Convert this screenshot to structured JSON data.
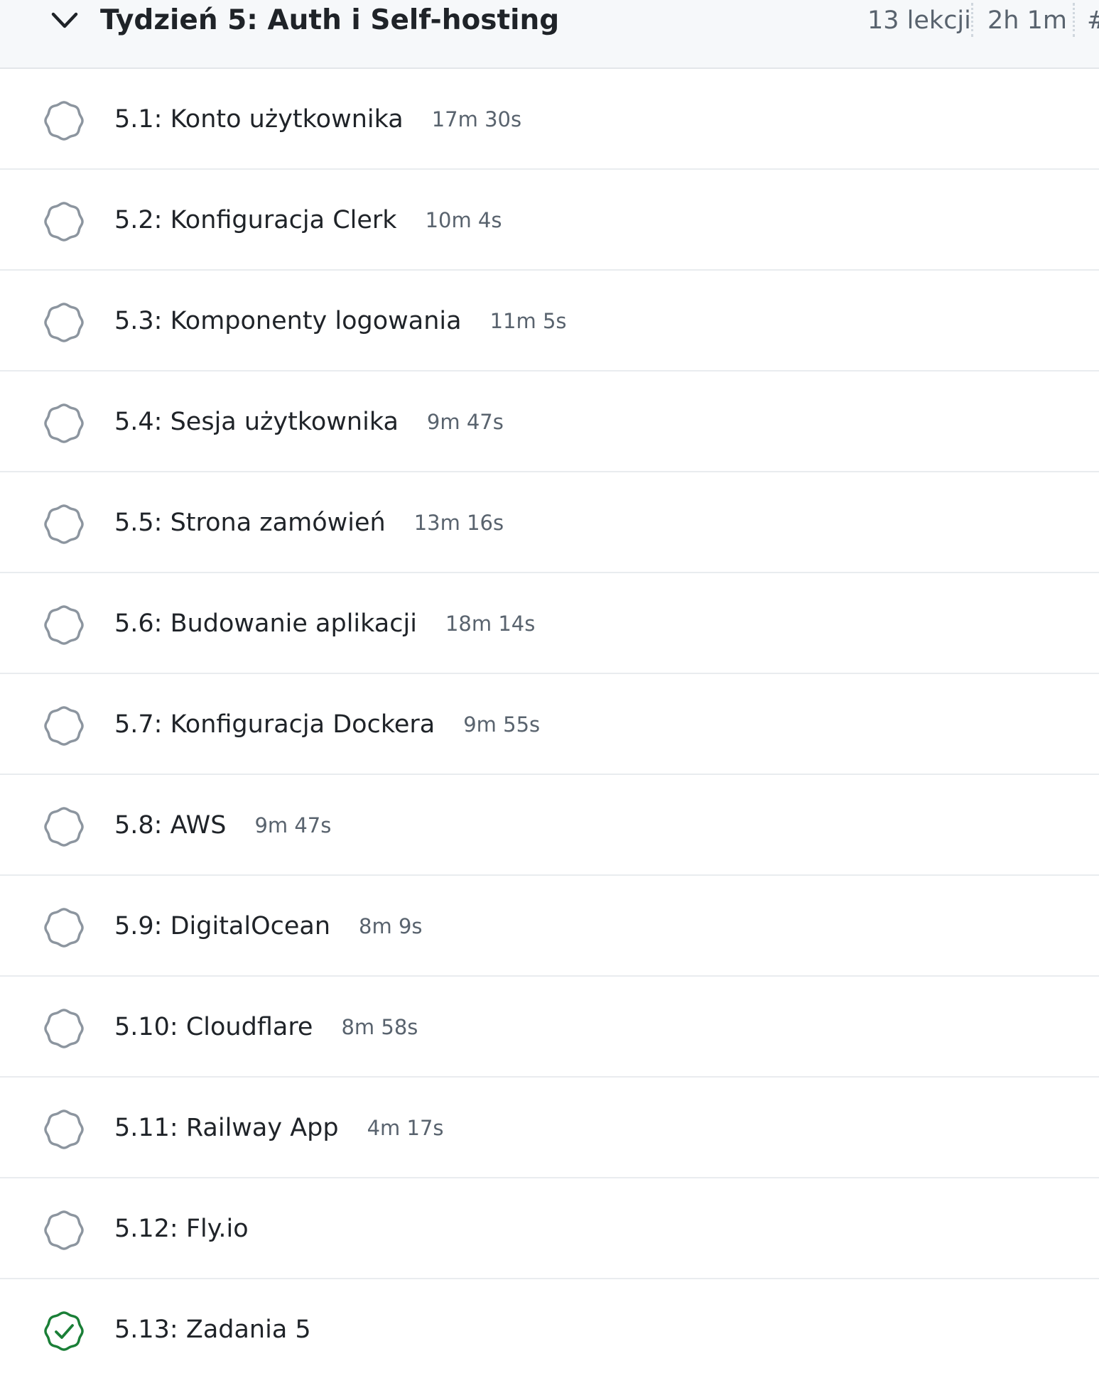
{
  "section": {
    "title": "Tydzień 5: Auth i Self-hosting",
    "lesson_count": "13 lekcji",
    "duration": "2h 1m",
    "extra": "#",
    "toggle_icon": "chevron-down-icon"
  },
  "colors": {
    "header_bg": "#f6f8fa",
    "pending": "#8c959f",
    "done": "#1a7f37",
    "text": "#1f2328",
    "muted": "#59636e"
  },
  "lessons": [
    {
      "title": "5.1: Konto użytkownika",
      "duration": "17m 30s",
      "completed": false
    },
    {
      "title": "5.2: Konfiguracja Clerk",
      "duration": "10m 4s",
      "completed": false
    },
    {
      "title": "5.3: Komponenty logowania",
      "duration": "11m 5s",
      "completed": false
    },
    {
      "title": "5.4: Sesja użytkownika",
      "duration": "9m 47s",
      "completed": false
    },
    {
      "title": "5.5: Strona zamówień",
      "duration": "13m 16s",
      "completed": false
    },
    {
      "title": "5.6: Budowanie aplikacji",
      "duration": "18m 14s",
      "completed": false
    },
    {
      "title": "5.7: Konfiguracja Dockera",
      "duration": "9m 55s",
      "completed": false
    },
    {
      "title": "5.8: AWS",
      "duration": "9m 47s",
      "completed": false
    },
    {
      "title": "5.9: DigitalOcean",
      "duration": "8m 9s",
      "completed": false
    },
    {
      "title": "5.10: Cloudflare",
      "duration": "8m 58s",
      "completed": false
    },
    {
      "title": "5.11: Railway App",
      "duration": "4m 17s",
      "completed": false
    },
    {
      "title": "5.12: Fly.io",
      "duration": "",
      "completed": false
    },
    {
      "title": "5.13: Zadania 5",
      "duration": "",
      "completed": true
    }
  ]
}
